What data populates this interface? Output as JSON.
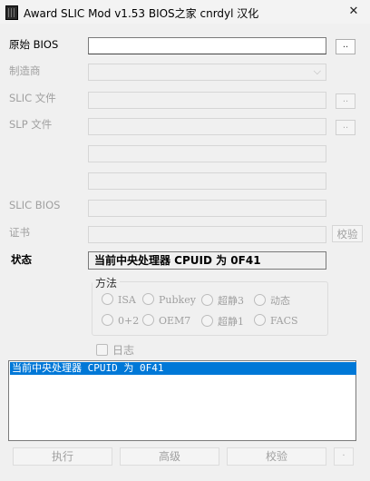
{
  "window": {
    "title": "Award SLIC Mod v1.53  BIOS之家 cnrdyl 汉化",
    "close_glyph": "✕"
  },
  "labels": {
    "original_bios": "原始 BIOS",
    "manufacturer": "制造商",
    "slic_file": "SLIC 文件",
    "slp_file": "SLP 文件",
    "slic_bios": "SLIC BIOS",
    "certificate": "证书",
    "status": "状态"
  },
  "browse_label": "..",
  "verify_label": "校验",
  "status_value": "当前中央处理器 CPUID 为 0F41",
  "method": {
    "title": "方法",
    "options": [
      "ISA",
      "Pubkey",
      "超静3",
      "动态",
      "0+2",
      "OEM7",
      "超静1",
      "FACS"
    ]
  },
  "log_checkbox": "日志",
  "log_lines": [
    "当前中央处理器 CPUID 为 0F41"
  ],
  "buttons": {
    "execute": "执行",
    "advanced": "高级",
    "verify": "校验",
    "extra": "·"
  },
  "icons": {
    "dropdown": "chevron-down-icon",
    "app": "app-icon"
  }
}
